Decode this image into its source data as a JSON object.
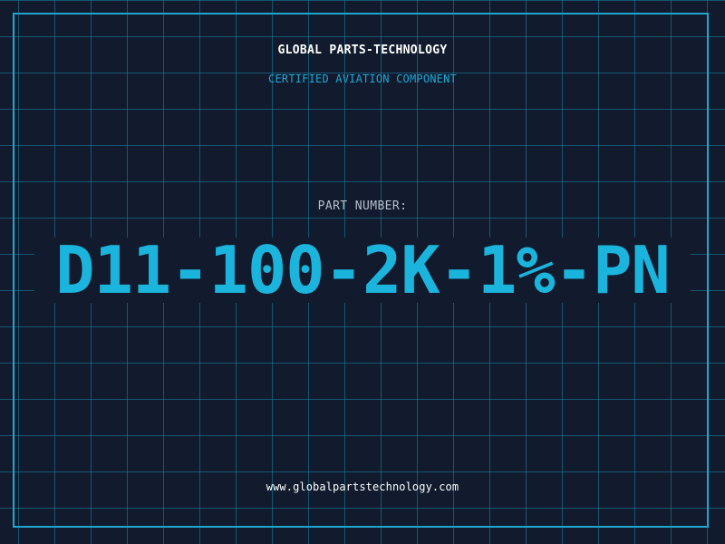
{
  "label": {
    "company": "GLOBAL PARTS-TECHNOLOGY",
    "subtitle": "CERTIFIED AVIATION COMPONENT",
    "part_label": "PART NUMBER:",
    "part_number": "D11-100-2K-1%-PN",
    "website": "www.globalpartstechnology.com"
  },
  "colors": {
    "background": "#111b2d",
    "grid": "#1887aa",
    "frame": "#1fa6cf",
    "accent": "#1ab4dd",
    "text": "#ffffff",
    "muted": "#b7bfca"
  }
}
